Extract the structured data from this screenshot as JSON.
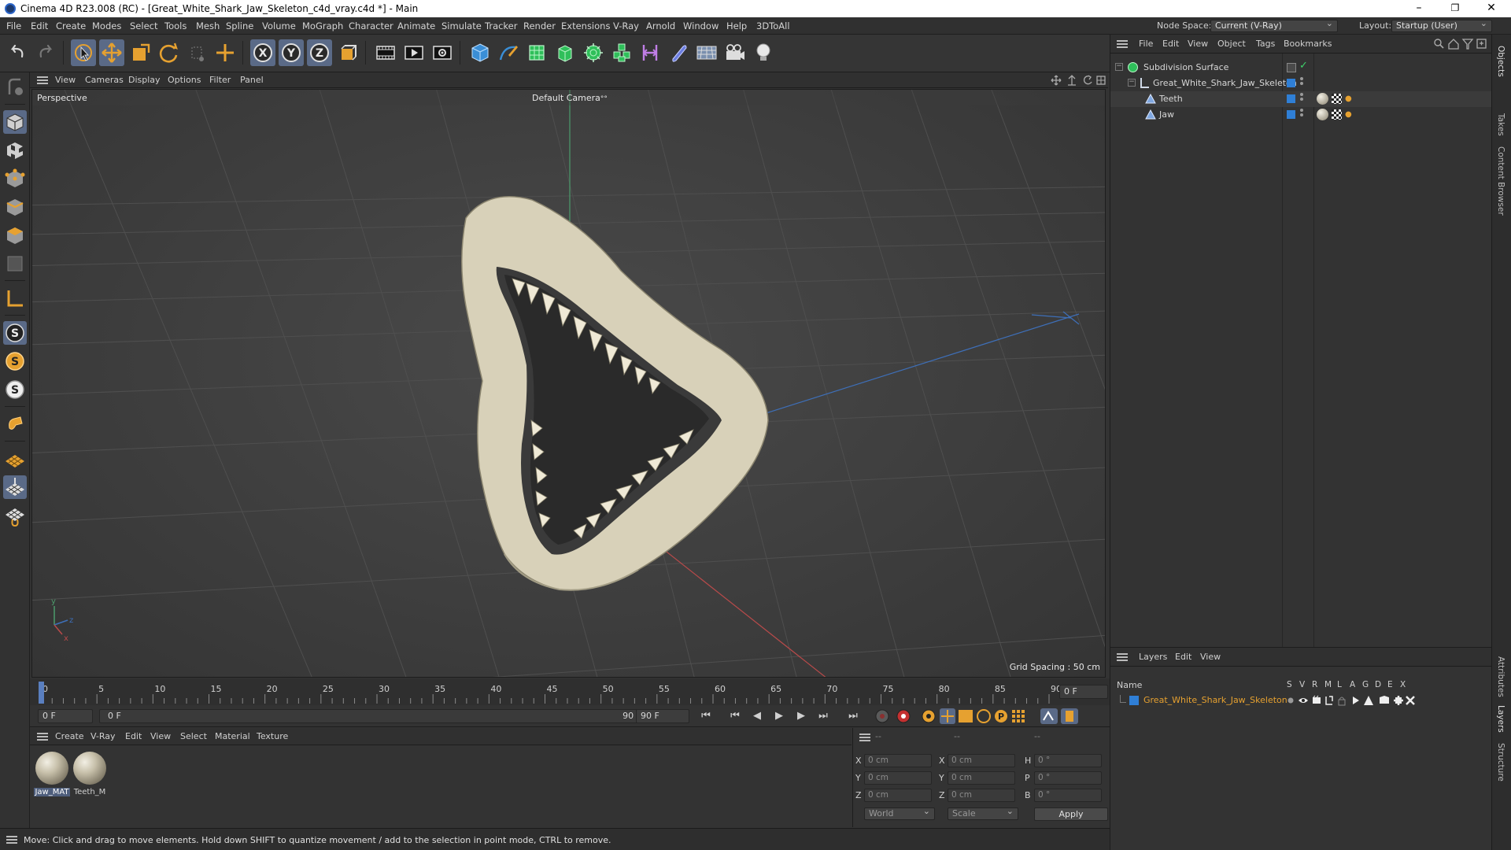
{
  "window": {
    "title": "Cinema 4D R23.008 (RC) - [Great_White_Shark_Jaw_Skeleton_c4d_vray.c4d *] - Main",
    "minimize": "–",
    "maximize": "❐",
    "close": "✕"
  },
  "menubar": {
    "items": [
      "File",
      "Edit",
      "Create",
      "Modes",
      "Select",
      "Tools",
      "Mesh",
      "Spline",
      "Volume",
      "MoGraph",
      "Character",
      "Animate",
      "Simulate",
      "Tracker",
      "Render",
      "Extensions",
      "V-Ray",
      "Arnold",
      "Window",
      "Help",
      "3DToAll"
    ],
    "node_space_label": "Node Space:",
    "node_space_value": "Current (V-Ray)",
    "layout_label": "Layout:",
    "layout_value": "Startup (User)"
  },
  "toolbar": {
    "axis_x": "X",
    "axis_y": "Y",
    "axis_z": "Z"
  },
  "left_tools": {
    "s1": "S",
    "s2": "S",
    "s3": "S"
  },
  "viewport": {
    "menu": [
      "View",
      "Cameras",
      "Display",
      "Options",
      "Filter",
      "Panel"
    ],
    "label": "Perspective",
    "camera": "Default Camera",
    "camera_icon": "°°",
    "grid_spacing": "Grid Spacing : 50 cm",
    "axis_y": "y",
    "axis_z": "z",
    "axis_x": "x"
  },
  "timeline": {
    "ticks": [
      "0",
      "5",
      "10",
      "15",
      "20",
      "25",
      "30",
      "35",
      "40",
      "45",
      "50",
      "55",
      "60",
      "65",
      "70",
      "75",
      "80",
      "85",
      "90"
    ],
    "current_frame_field": "0 F",
    "start_field": "0 F",
    "range_start": "0 F",
    "range_end": "90 F",
    "end_field": "90 F",
    "playhead_frame": 0,
    "max_frame": 90
  },
  "material_manager": {
    "menu": [
      "Create",
      "V-Ray",
      "Edit",
      "View",
      "Select",
      "Material",
      "Texture"
    ],
    "materials": [
      {
        "name": "Jaw_MAT",
        "selected": true
      },
      {
        "name": "Teeth_M",
        "selected": false
      }
    ]
  },
  "coordinates": {
    "headers": [
      "--",
      "--",
      "--"
    ],
    "rows": [
      {
        "l1": "X",
        "v1": "0 cm",
        "l2": "X",
        "v2": "0 cm",
        "l3": "H",
        "v3": "0 °"
      },
      {
        "l1": "Y",
        "v1": "0 cm",
        "l2": "Y",
        "v2": "0 cm",
        "l3": "P",
        "v3": "0 °"
      },
      {
        "l1": "Z",
        "v1": "0 cm",
        "l2": "Z",
        "v2": "0 cm",
        "l3": "B",
        "v3": "0 °"
      }
    ],
    "mode": "World",
    "type": "Scale",
    "apply": "Apply"
  },
  "statusbar": {
    "message": "Move: Click and drag to move elements. Hold down SHIFT to quantize movement / add to the selection in point mode, CTRL to remove."
  },
  "object_manager": {
    "menu": [
      "File",
      "Edit",
      "View",
      "Object",
      "Tags",
      "Bookmarks"
    ],
    "objects": [
      {
        "name": "Subdivision Surface"
      },
      {
        "name": "Great_White_Shark_Jaw_Skeleton"
      },
      {
        "name": "Teeth"
      },
      {
        "name": "Jaw"
      }
    ]
  },
  "layers_manager": {
    "menu": [
      "Layers",
      "Edit",
      "View"
    ],
    "name_header": "Name",
    "flag_headers": [
      "S",
      "V",
      "R",
      "M",
      "L",
      "A",
      "G",
      "D",
      "E",
      "X"
    ],
    "layers": [
      {
        "name": "Great_White_Shark_Jaw_Skeleton",
        "color": "#2f7fd6"
      }
    ]
  },
  "side_tabs": [
    "Objects",
    "Takes",
    "Content Browser",
    "Attributes",
    "Layers",
    "Structure"
  ]
}
